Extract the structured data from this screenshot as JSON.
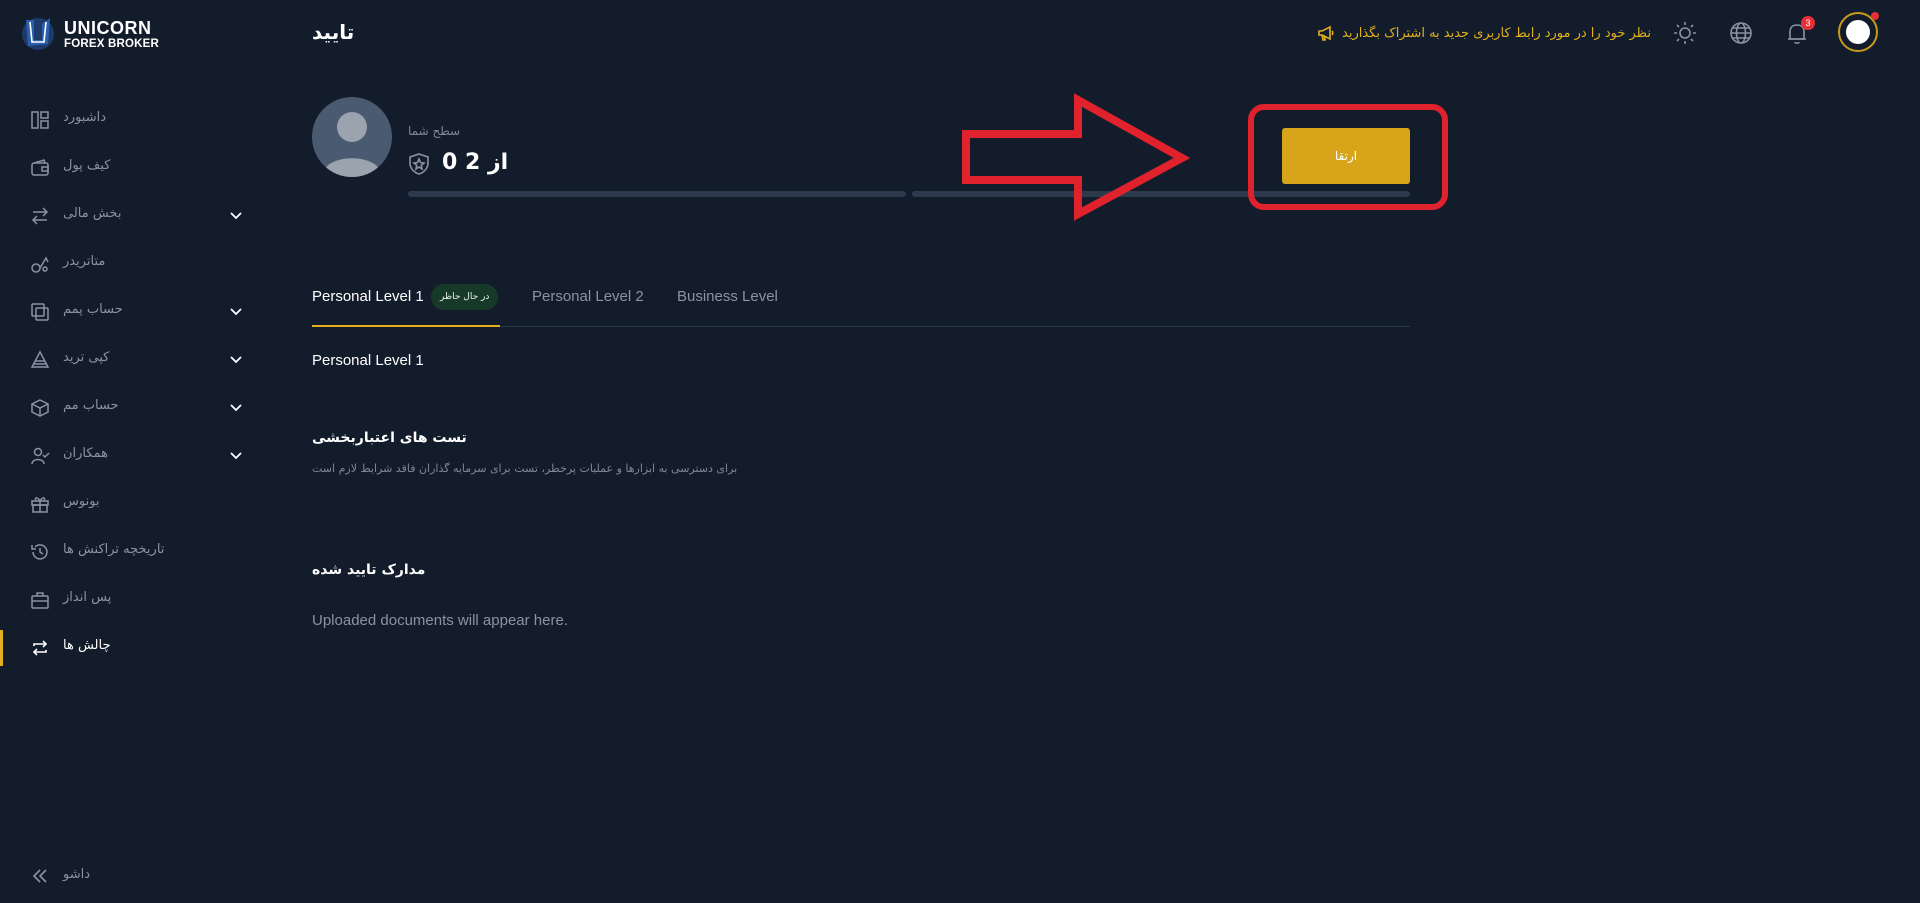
{
  "brand": {
    "line1": "UNICORN",
    "line2": "FOREX BROKER"
  },
  "sidebar": {
    "items": [
      {
        "label": "داشبورد",
        "icon": "dashboard-icon",
        "expandable": false
      },
      {
        "label": "کیف پول",
        "icon": "wallet-icon",
        "expandable": false
      },
      {
        "label": "بخش مالی",
        "icon": "transfer-arrows-icon",
        "expandable": true
      },
      {
        "label": "متاتریدر",
        "icon": "metatrader-icon",
        "expandable": false
      },
      {
        "label": "حساب پمم",
        "icon": "pamm-account-icon",
        "expandable": true
      },
      {
        "label": "کپی ترید",
        "icon": "copy-trade-icon",
        "expandable": true
      },
      {
        "label": "حساب مم",
        "icon": "cube-icon",
        "expandable": true
      },
      {
        "label": "همکاران",
        "icon": "partners-icon",
        "expandable": true
      },
      {
        "label": "بونوس",
        "icon": "gift-icon",
        "expandable": false
      },
      {
        "label": "تاریخچه تراکنش ها",
        "icon": "history-icon",
        "expandable": false
      },
      {
        "label": "پس انداز",
        "icon": "savings-icon",
        "expandable": false
      },
      {
        "label": "چالش ها",
        "icon": "challenges-icon",
        "expandable": false,
        "active": true
      }
    ],
    "collapse_label": "داشو"
  },
  "header": {
    "title": "تایید",
    "feedback_text": "نظر خود را در مورد رابط کاربری جدید به اشتراک بگذارید",
    "notification_count": "3"
  },
  "level": {
    "caption": "سطح شما",
    "value": "از 2 0",
    "upgrade_label": "ارتقا",
    "progress_fraction": 0
  },
  "tabs": [
    {
      "label": "Personal Level 1",
      "badge": "در حال حاظر",
      "active": true
    },
    {
      "label": "Personal Level 2"
    },
    {
      "label": "Business Level"
    }
  ],
  "content": {
    "section_title": "Personal Level 1",
    "tests_title": "تست های اعتباربخشی",
    "tests_description": "برای دسترسی به ابزارها و عملیات پرخطر، تست برای سرمایه گذاران فاقد شرایط لازم است",
    "docs_title": "مدارک تایید شده",
    "docs_empty": "Uploaded documents will appear here."
  },
  "colors": {
    "background": "#131c2b",
    "accent": "#e2b01e",
    "button": "#d8a41a",
    "annotation_red": "#e0222d",
    "badge_green": "#17392a"
  }
}
